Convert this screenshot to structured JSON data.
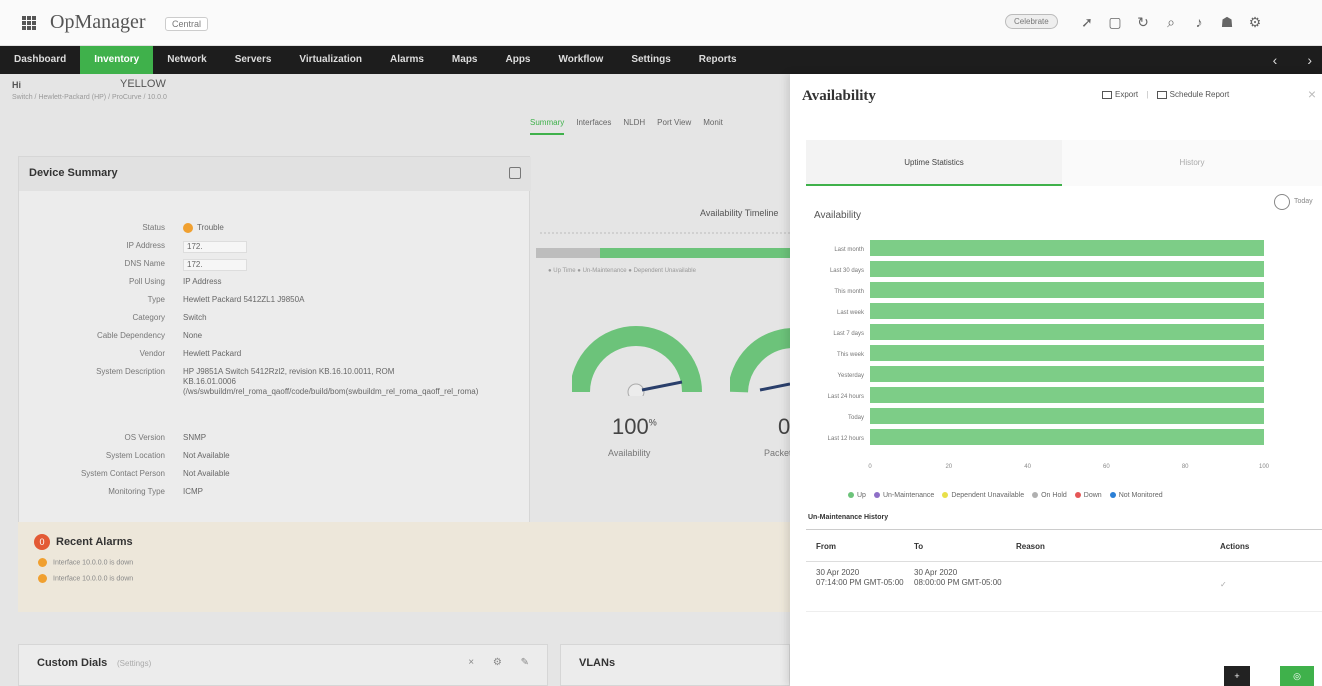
{
  "app": {
    "title": "OpManager",
    "badge": "Central"
  },
  "header": {
    "pill": "Celebrate",
    "icons": [
      "rocket-icon",
      "monitor-icon",
      "refresh-icon",
      "search-icon",
      "bell-icon",
      "robot-icon",
      "gear-icon"
    ]
  },
  "nav": {
    "items": [
      "Dashboard",
      "Inventory",
      "Network",
      "Servers",
      "Virtualization",
      "Alarms",
      "Maps",
      "Apps",
      "Workflow",
      "Settings",
      "Reports"
    ],
    "active_index": 1
  },
  "device": {
    "name": "Hi",
    "status": "YELLOW",
    "path": "Switch / Hewlett-Packard (HP) / ProCurve / 10.0.0"
  },
  "device_tabs": [
    "Summary",
    "Interfaces",
    "NLDH",
    "Port View",
    "Monit"
  ],
  "summary": {
    "title": "Device Summary",
    "rows": [
      {
        "k": "Status",
        "v": "Trouble"
      },
      {
        "k": "IP Address",
        "v": "172."
      },
      {
        "k": "DNS Name",
        "v": "172."
      },
      {
        "k": "Poll Using",
        "v": "IP Address"
      },
      {
        "k": "Type",
        "v": "Hewlett Packard 5412ZL1 J9850A"
      },
      {
        "k": "Category",
        "v": "Switch"
      },
      {
        "k": "Cable Dependency",
        "v": "None"
      },
      {
        "k": "Vendor",
        "v": "Hewlett Packard"
      },
      {
        "k": "System Description",
        "v": "HP J9851A Switch 5412Rzl2, revision KB.16.10.0011, ROM KB.16.01.0006 (/ws/swbuildm/rel_roma_qaoff/code/build/bom(swbuildm_rel_roma_qaoff_rel_roma)"
      },
      {
        "k": "OS Version",
        "v": "SNMP"
      },
      {
        "k": "System Location",
        "v": "Not Available"
      },
      {
        "k": "System Contact Person",
        "v": "Not Available"
      },
      {
        "k": "Monitoring Type",
        "v": "ICMP"
      }
    ]
  },
  "alarms": {
    "title": "Recent Alarms",
    "count": "0",
    "items": [
      "Interface 10.0.0.0 is down",
      "Interface 10.0.0.0 is down"
    ]
  },
  "timeline": {
    "title": "Availability Timeline",
    "legend": "● Up Time  ● Un-Maintenance  ● Dependent Unavailable"
  },
  "gauges": [
    {
      "value": "100",
      "unit": "%",
      "label": "Availability"
    },
    {
      "value": "0",
      "unit": "",
      "label": "Packet"
    }
  ],
  "dials": {
    "title": "Custom Dials",
    "sub": "(Settings)"
  },
  "vlans": {
    "title": "VLANs"
  },
  "panel": {
    "title": "Availability",
    "export": "Export",
    "schedule": "Schedule Report",
    "tabs": [
      "Uptime Statistics",
      "History"
    ],
    "clock_label": "Today",
    "chart_title": "Availability"
  },
  "chart_data": {
    "type": "bar",
    "orientation": "horizontal",
    "title": "Availability",
    "categories": [
      "Last month",
      "Last 30 days",
      "This month",
      "Last week",
      "Last 7 days",
      "This week",
      "Yesterday",
      "Last 24 hours",
      "Today",
      "Last 12 hours"
    ],
    "series": [
      {
        "name": "Up",
        "values": [
          100,
          100,
          100,
          100,
          100,
          100,
          100,
          100,
          100,
          100
        ]
      }
    ],
    "xticks": [
      "0",
      "20",
      "40",
      "60",
      "80",
      "100"
    ],
    "xlim": [
      0,
      100
    ],
    "legend": [
      "Up",
      "Un-Maintenance",
      "Dependent Unavailable",
      "On Hold",
      "Down",
      "Not Monitored"
    ],
    "legend_colors": [
      "#6cc37a",
      "#8e6fc7",
      "#e8e04a",
      "#b0b0b0",
      "#e55656",
      "#2a7fd6"
    ],
    "bar_color": "#7dcd87"
  },
  "maintenance": {
    "title": "Un-Maintenance History",
    "headers": [
      "From",
      "To",
      "Reason",
      "Actions"
    ],
    "rows": [
      {
        "from": "30 Apr 2020\n07:14:00 PM GMT-05:00",
        "to": "30 Apr 2020\n08:00:00 PM GMT-05:00",
        "reason": "",
        "action": "✓"
      }
    ]
  },
  "buttons": {
    "dark": "+",
    "green": "◎"
  }
}
